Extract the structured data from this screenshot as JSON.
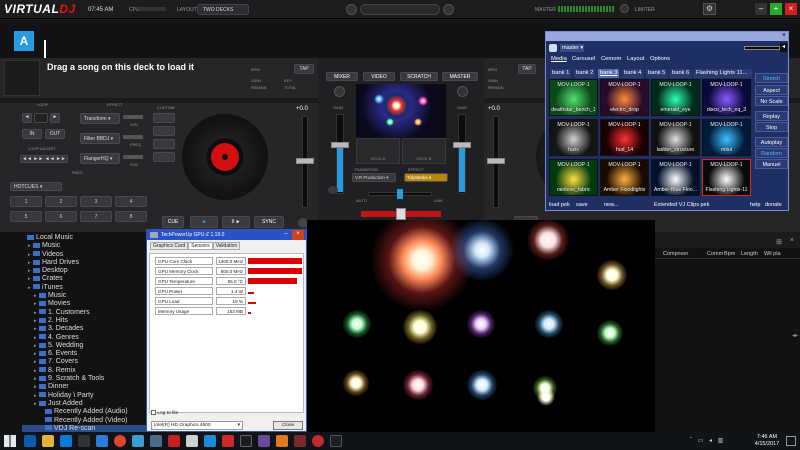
{
  "topbar": {
    "app_name_1": "VIRTUAL",
    "app_name_2": "DJ",
    "clock": "07:45 AM",
    "cpu_label": "CPU",
    "layout_label": "LAYOUT",
    "layout_value": "TWO DECKS",
    "master_label": "MASTER",
    "limiter_label": "LIMITER",
    "win_min": "–",
    "win_max": "+",
    "win_close": "×"
  },
  "deck_a": {
    "letter": "A",
    "prompt": "Drag a song on this deck to load it",
    "bpm": "BPM",
    "gain": "GAIN",
    "remain": "REMAIN",
    "key": "KEY",
    "total": "TOTAL",
    "tap": "TAP",
    "loop": "LOOP",
    "effect": "EFFECT",
    "in": "IN",
    "out": "OUT",
    "loop_adjust": "LOOP ADJUST",
    "custom": "CUSTOM",
    "fx1": "Transform",
    "fx2": "Filter BBDJ",
    "fx3": "FlangerHQ",
    "len": "LEN",
    "freq": "FREQ",
    "dw": "D/W",
    "pads": "PADS",
    "hotcues": "HOTCUES",
    "cue": "CUE",
    "play": "■",
    "pause": "II ►",
    "sync": "SYNC",
    "pitch": "+0.0",
    "pads_list": [
      "1",
      "2",
      "3",
      "4",
      "5",
      "6",
      "7",
      "8"
    ]
  },
  "deck_b": {
    "bpm": "BPM",
    "gain": "GAIN",
    "remain": "REMAIN",
    "tap": "TAP",
    "pitch": "+0.0"
  },
  "mixer": {
    "tab_mixer": "MIXER",
    "tab_video": "VIDEO",
    "tab_scratch": "SCRATCH",
    "tab_master": "MASTER",
    "gain": "GAIN",
    "transition": "TRANSITION",
    "effect": "EFFECT",
    "transition_value": "V.R Production",
    "effect_value": "TidyMedia",
    "deck_a": "DECK A",
    "deck_b": "DECK B",
    "auto": "AUTO",
    "link": "LINK"
  },
  "browser": {
    "items": [
      {
        "label": "Local Music",
        "indent": 0
      },
      {
        "label": "Music",
        "indent": 1
      },
      {
        "label": "Videos",
        "indent": 1
      },
      {
        "label": "Hard Drives",
        "indent": 1
      },
      {
        "label": "Desktop",
        "indent": 1
      },
      {
        "label": "Crates",
        "indent": 1
      },
      {
        "label": "iTunes",
        "indent": 1
      },
      {
        "label": "Music",
        "indent": 2
      },
      {
        "label": "Movies",
        "indent": 2
      },
      {
        "label": "1. Customers",
        "indent": 2
      },
      {
        "label": "2. Hits",
        "indent": 2
      },
      {
        "label": "3. Decades",
        "indent": 2
      },
      {
        "label": "4. Genres",
        "indent": 2
      },
      {
        "label": "5. Wedding",
        "indent": 2
      },
      {
        "label": "6. Events",
        "indent": 2
      },
      {
        "label": "7. Covers",
        "indent": 2
      },
      {
        "label": "8. Remix",
        "indent": 2
      },
      {
        "label": "9. Scratch & Tools",
        "indent": 2
      },
      {
        "label": "Dinner",
        "indent": 2
      },
      {
        "label": "Holiday \\ Party",
        "indent": 2
      },
      {
        "label": "Just Added",
        "indent": 2
      },
      {
        "label": "Recently Added (Audio)",
        "indent": 3
      },
      {
        "label": "Recently Added (Video)",
        "indent": 3
      },
      {
        "label": "VDJ Re-scan",
        "indent": 3
      }
    ]
  },
  "gpuz": {
    "title": "TechPowerUp GPU-Z 1.19.0",
    "tabs": [
      "Graphics Card",
      "Sensors",
      "Validation"
    ],
    "rows": [
      {
        "name": "GPU Core Clock",
        "value": "1300.0 MHz",
        "bar": 1.0
      },
      {
        "name": "GPU Memory Clock",
        "value": "800.0 MHz",
        "bar": 1.0
      },
      {
        "name": "GPU Temperature",
        "value": "55.0 °C",
        "bar": 0.9
      },
      {
        "name": "GPU Power",
        "value": "1.4 W",
        "bar": 0.12
      },
      {
        "name": "GPU Load",
        "value": "15 %",
        "bar": 0.15
      },
      {
        "name": "Memory Usage",
        "value": "153 MB",
        "bar": 0.05
      }
    ],
    "log_label": "Log to file",
    "gpu_select": "Intel(R) HD Graphics 4600",
    "close": "Close"
  },
  "tidy": {
    "master": "master",
    "tabs": [
      "Media",
      "Carousel",
      "Cemom",
      "Layout",
      "Options"
    ],
    "banks": [
      "bank 1",
      "bank 2",
      "bank 3",
      "bank 4",
      "bank 5",
      "bank 6",
      "Flashing Lights 11..."
    ],
    "cells": [
      {
        "label": "MOV-LOOP-1",
        "sub": "deathstar_bench_1",
        "c1": "#0a4a18",
        "c2": "#52e070"
      },
      {
        "label": "MOV-LOOP-1",
        "sub": "electro_drop",
        "c1": "#2a0a2a",
        "c2": "#ff8a3a"
      },
      {
        "label": "MOV-LOOP-1",
        "sub": "emerald_eye",
        "c1": "#002a1a",
        "c2": "#30ffb0"
      },
      {
        "label": "MOV-LOOP-1",
        "sub": "disco_tech_eq_3",
        "c1": "#0a0a3a",
        "c2": "#8a5aff"
      },
      {
        "label": "MOV-LOOP-1",
        "sub": "fuzix",
        "c1": "#141414",
        "c2": "#d0d0d0"
      },
      {
        "label": "MOV-LOOP-1",
        "sub": "hud_14",
        "c1": "#1a0000",
        "c2": "#ff3030"
      },
      {
        "label": "MOV-LOOP-1",
        "sub": "ladder_structure",
        "c1": "#101010",
        "c2": "#e0e0e0"
      },
      {
        "label": "MOV-LOOP-1",
        "sub": "mitul",
        "c1": "#001a3a",
        "c2": "#40c0ff"
      },
      {
        "label": "MOV-LOOP-1",
        "sub": "rainbow_fabric",
        "c1": "#003a10",
        "c2": "#ffe040"
      },
      {
        "label": "MOV-LOOP-1",
        "sub": "Amber Floodlights",
        "c1": "#1a0a00",
        "c2": "#ffb040"
      },
      {
        "label": "MOV-LOOP-1",
        "sub": "Amber-Blue Floo...",
        "c1": "#00102a",
        "c2": "#ffffff"
      },
      {
        "label": "MOV-LOOP-1",
        "sub": "Flashing Lights-11",
        "c1": "#0a0a0a",
        "c2": "#ffffff"
      }
    ],
    "right_buttons": [
      "Stretch",
      "Aspect",
      "No Scale",
      "Replay",
      "Stop",
      "Autoplay",
      "Random",
      "Manuel"
    ],
    "footer_left": "load pek",
    "footer_save": "save",
    "footer_new": "new...",
    "footer_center": "Extended VJ Clips pek",
    "footer_help": "help",
    "footer_donate": "donate"
  },
  "table": {
    "columns": [
      "Composer",
      "Comm",
      "Bpm",
      "Length",
      "Wil pla"
    ]
  },
  "taskbar": {
    "time": "7:46 AM",
    "date": "4/15/2017"
  },
  "colors": {
    "accent": "#2a9ae0",
    "red": "#e01818",
    "tidy_bg": "#1f2f64"
  }
}
